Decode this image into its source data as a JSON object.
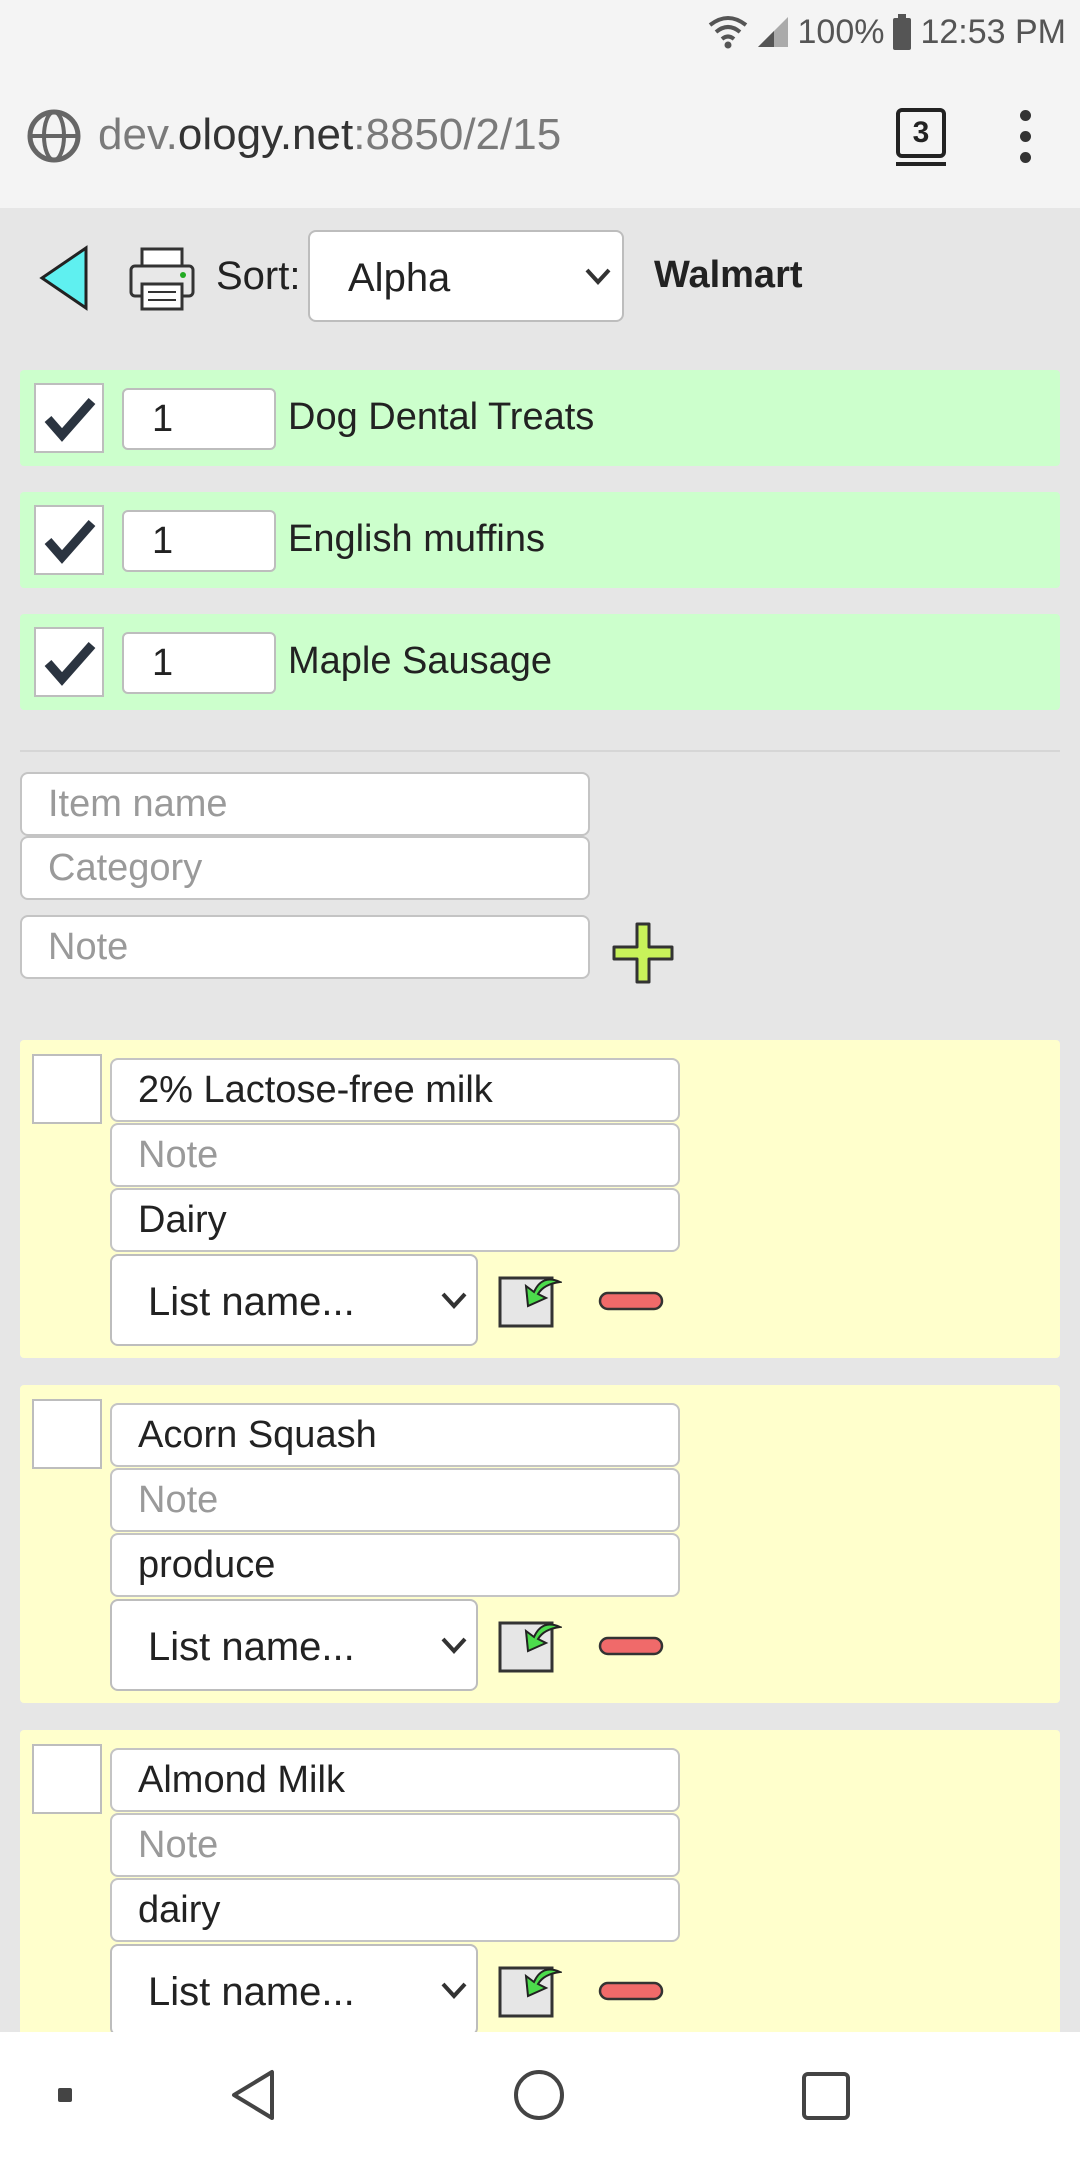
{
  "status_bar": {
    "battery": "100%",
    "time": "12:53 PM",
    "icons": [
      "wifi-icon",
      "signal-icon",
      "battery-icon"
    ]
  },
  "browser": {
    "url_prefix": "dev.",
    "url_domain": "ology.net",
    "url_suffix": ":8850/2/15",
    "tab_count": "3"
  },
  "toolbar": {
    "sort_label": "Sort:",
    "sort_value": "Alpha",
    "store": "Walmart"
  },
  "checked_items": [
    {
      "qty": "1",
      "name": "Dog Dental Treats"
    },
    {
      "qty": "1",
      "name": "English muffins"
    },
    {
      "qty": "1",
      "name": "Maple Sausage"
    }
  ],
  "add_form": {
    "item_placeholder": "Item name",
    "category_placeholder": "Category",
    "note_placeholder": "Note"
  },
  "items": [
    {
      "name": "2% Lactose-free milk",
      "note_placeholder": "Note",
      "category": "Dairy",
      "list_select": "List name..."
    },
    {
      "name": "Acorn Squash",
      "note_placeholder": "Note",
      "category": "produce",
      "list_select": "List name..."
    },
    {
      "name": "Almond Milk",
      "note_placeholder": "Note",
      "category": "dairy",
      "list_select": "List name..."
    }
  ],
  "colors": {
    "checked_bg": "#ccffcc",
    "unchecked_bg": "#ffffcc",
    "back_arrow": "#5ff0f0",
    "plus": "#c8f25a",
    "remove": "#f06a6a"
  }
}
